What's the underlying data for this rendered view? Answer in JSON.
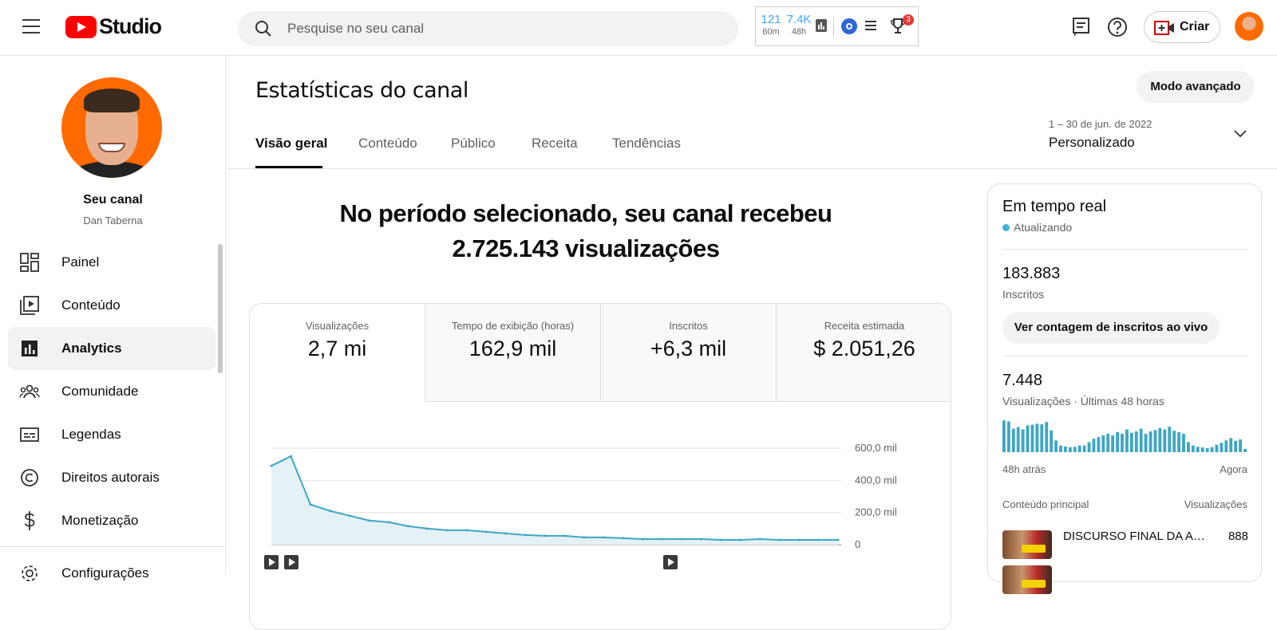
{
  "header": {
    "logo_text": "Studio",
    "search_placeholder": "Pesquise no seu canal",
    "extension": {
      "stat1_value": "121",
      "stat1_unit": "60m",
      "stat2_value": "7.4K",
      "stat2_unit": "48h",
      "badge_count": "3"
    },
    "create_label": "Criar"
  },
  "sidebar": {
    "channel_title": "Seu canal",
    "channel_name": "Dan Taberna",
    "items": [
      {
        "label": "Painel",
        "icon": "dashboard-icon"
      },
      {
        "label": "Conteúdo",
        "icon": "content-icon"
      },
      {
        "label": "Analytics",
        "icon": "analytics-icon",
        "active": true
      },
      {
        "label": "Comunidade",
        "icon": "community-icon"
      },
      {
        "label": "Legendas",
        "icon": "subtitles-icon"
      },
      {
        "label": "Direitos autorais",
        "icon": "copyright-icon"
      },
      {
        "label": "Monetização",
        "icon": "dollar-icon"
      },
      {
        "label": "Configurações",
        "icon": "settings-icon"
      }
    ]
  },
  "main": {
    "title": "Estatísticas do canal",
    "advanced_button": "Modo avançado",
    "tabs": [
      {
        "label": "Visão geral",
        "active": true
      },
      {
        "label": "Conteúdo"
      },
      {
        "label": "Público"
      },
      {
        "label": "Receita"
      },
      {
        "label": "Tendências"
      }
    ],
    "date_range": {
      "period": "1 – 30 de jun. de 2022",
      "label": "Personalizado"
    },
    "headline_line1": "No período selecionado, seu canal recebeu",
    "headline_line2": "2.725.143 visualizações",
    "metrics": [
      {
        "label": "Visualizações",
        "value": "2,7 mi"
      },
      {
        "label": "Tempo de exibição (horas)",
        "value": "162,9 mil"
      },
      {
        "label": "Inscritos",
        "value": "+6,3 mil"
      },
      {
        "label": "Receita estimada",
        "value": "$ 2.051,26"
      }
    ]
  },
  "chart_data": {
    "type": "area",
    "series": [
      {
        "values": [
          490000,
          550000,
          250000,
          210000,
          180000,
          150000,
          140000,
          115000,
          100000,
          90000,
          90000,
          80000,
          70000,
          60000,
          55000,
          55000,
          45000,
          45000,
          40000,
          35000,
          35000,
          35000,
          35000,
          30000,
          30000,
          35000,
          30000,
          30000,
          30000,
          30000
        ]
      }
    ],
    "yticks": [
      "600,0 mil",
      "400,0 mil",
      "200,0 mil",
      "0"
    ],
    "ylim": [
      0,
      600000
    ],
    "grid": true,
    "color": "#3ea6c5"
  },
  "realtime": {
    "title": "Em tempo real",
    "status": "Atualizando",
    "subscribers_value": "183.883",
    "subscribers_label": "Inscritos",
    "live_button": "Ver contagem de inscritos ao vivo",
    "views_value": "7.448",
    "views_label": "Visualizações · Últimas 48 horas",
    "axis_left": "48h atrás",
    "axis_right": "Agora",
    "top_content_label": "Conteúdo principal",
    "top_views_label": "Visualizações",
    "top_rows": [
      {
        "title": "DISCURSO FINAL DA ADV...",
        "views": "888"
      }
    ],
    "mini_chart": [
      0.95,
      0.92,
      0.7,
      0.75,
      0.68,
      0.8,
      0.82,
      0.85,
      0.83,
      0.9,
      0.65,
      0.35,
      0.2,
      0.17,
      0.15,
      0.16,
      0.2,
      0.2,
      0.3,
      0.4,
      0.45,
      0.5,
      0.55,
      0.5,
      0.6,
      0.55,
      0.68,
      0.58,
      0.62,
      0.7,
      0.55,
      0.62,
      0.66,
      0.72,
      0.68,
      0.76,
      0.64,
      0.6,
      0.55,
      0.3,
      0.2,
      0.16,
      0.14,
      0.12,
      0.15,
      0.22,
      0.28,
      0.35,
      0.42,
      0.34,
      0.38,
      0.1
    ],
    "bar_color": "#3ea6c5"
  }
}
